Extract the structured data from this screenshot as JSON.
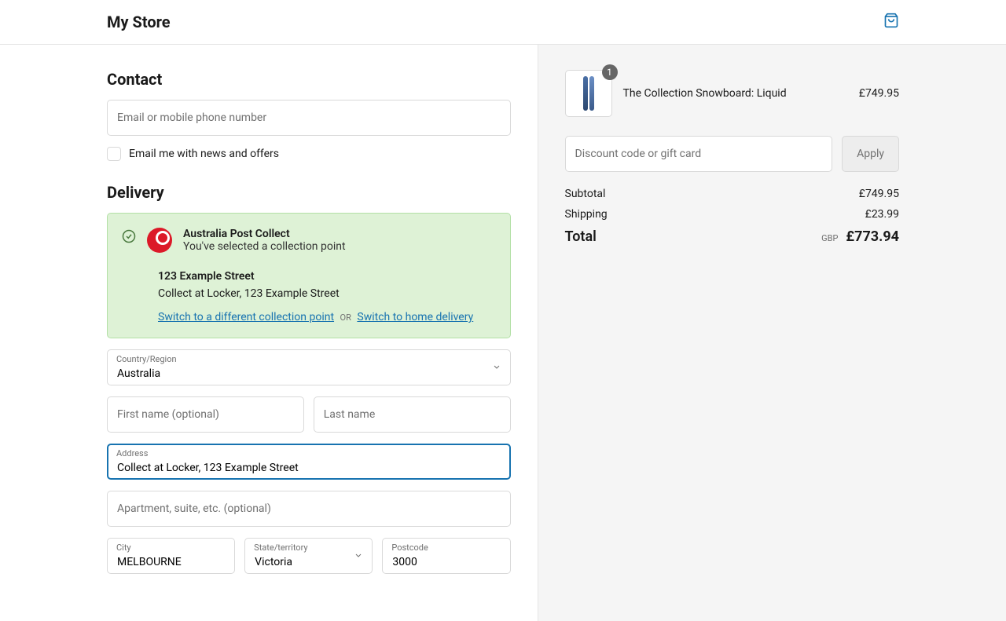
{
  "header": {
    "title": "My Store"
  },
  "contact": {
    "heading": "Contact",
    "email_placeholder": "Email or mobile phone number",
    "newsletter_label": "Email me with news and offers"
  },
  "delivery": {
    "heading": "Delivery",
    "collect": {
      "title": "Australia Post Collect",
      "subtitle": "You've selected a collection point",
      "addr_title": "123 Example Street",
      "addr_sub": "Collect at Locker, 123 Example Street",
      "switch_point": "Switch to a different collection point",
      "or": "OR",
      "switch_home": "Switch to home delivery"
    },
    "country_label": "Country/Region",
    "country_value": "Australia",
    "first_name_placeholder": "First name (optional)",
    "last_name_placeholder": "Last name",
    "address_label": "Address",
    "address_value": "Collect at Locker, 123 Example Street",
    "apt_placeholder": "Apartment, suite, etc. (optional)",
    "city_label": "City",
    "city_value": "MELBOURNE",
    "state_label": "State/territory",
    "state_value": "Victoria",
    "postcode_label": "Postcode",
    "postcode_value": "3000"
  },
  "cart": {
    "item_qty": "1",
    "item_name": "The Collection Snowboard: Liquid",
    "item_price": "£749.95",
    "discount_placeholder": "Discount code or gift card",
    "apply": "Apply",
    "subtotal_label": "Subtotal",
    "subtotal_value": "£749.95",
    "shipping_label": "Shipping",
    "shipping_value": "£23.99",
    "total_label": "Total",
    "currency": "GBP",
    "total_value": "£773.94"
  }
}
